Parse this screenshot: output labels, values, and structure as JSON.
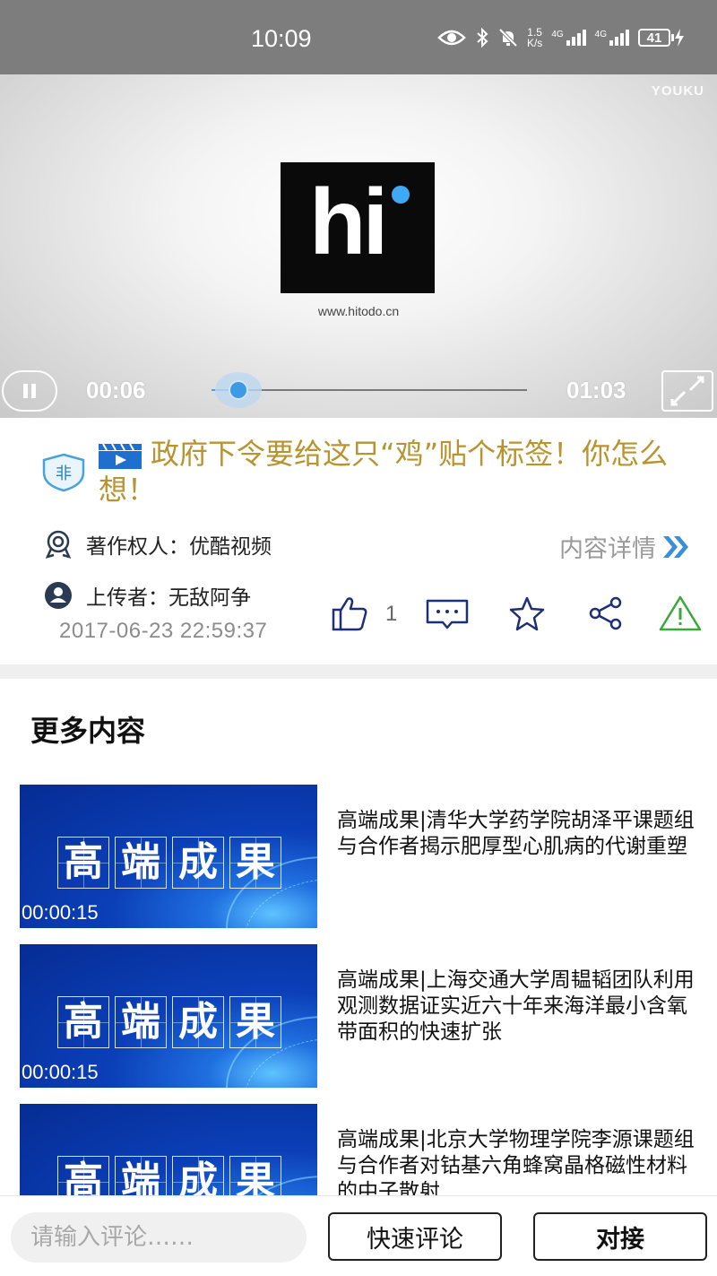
{
  "status_bar": {
    "time": "10:09",
    "net_speed_value": "1.5",
    "net_speed_unit": "K/s",
    "signal1_label": "4G",
    "signal2_label": "4G",
    "battery": "41"
  },
  "video": {
    "watermark": "YOUKU",
    "logo_text": "hi",
    "logo_url": "www.hitodo.cn",
    "current_time": "00:06",
    "total_time": "01:03",
    "progress": 0.095,
    "accent_color": "#3f9ae6"
  },
  "info": {
    "badge": "非",
    "title": "政府下令要给这只“鸡”贴个标签！你怎么想！",
    "title_color": "#b8942e",
    "copyright_label": "著作权人：",
    "copyright_value": "优酷视频",
    "detail_link": "内容详情",
    "uploader_label": "上传者：",
    "uploader_value": "无敌阿争",
    "date": "2017-06-23 22:59:37",
    "like_count": "1"
  },
  "more": {
    "section_title": "更多内容",
    "items": [
      {
        "thumb_chars": [
          "高",
          "端",
          "成",
          "果"
        ],
        "duration": "00:00:15",
        "title": "高端成果|清华大学药学院胡泽平课题组与合作者揭示肥厚型心肌病的代谢重塑"
      },
      {
        "thumb_chars": [
          "高",
          "端",
          "成",
          "果"
        ],
        "duration": "00:00:15",
        "title": "高端成果|上海交通大学周韫韬团队利用观测数据证实近六十年来海洋最小含氧带面积的快速扩张"
      },
      {
        "thumb_chars": [
          "高",
          "端",
          "成",
          "果"
        ],
        "duration": "",
        "title": "高端成果|北京大学物理学院李源课题组与合作者对钴基六角蜂窝晶格磁性材料的中子散射"
      }
    ]
  },
  "bottom": {
    "comment_placeholder": "请输入评论……",
    "quick_comment": "快速评论",
    "dock_button": "对接"
  }
}
